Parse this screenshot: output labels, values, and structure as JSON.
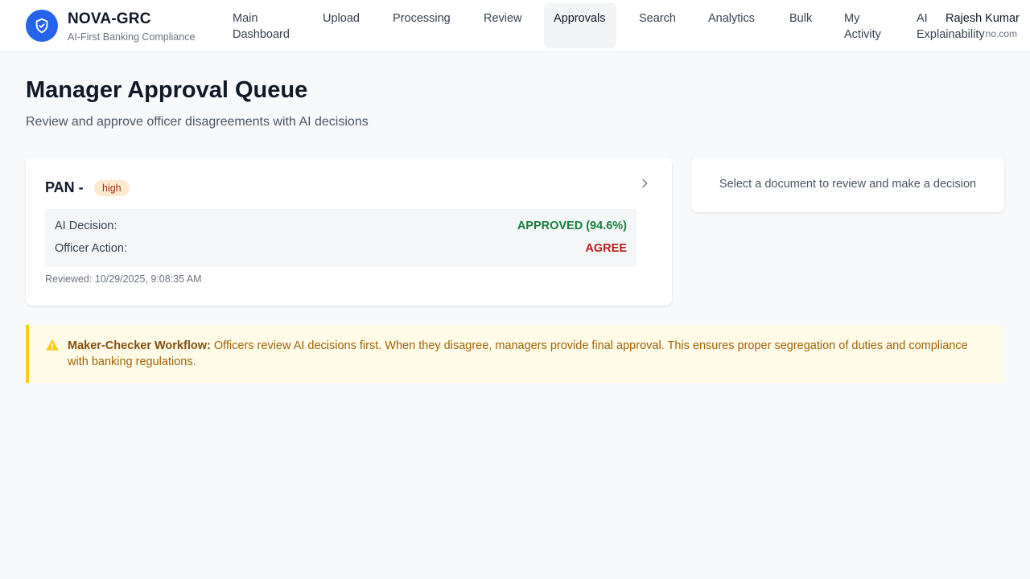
{
  "brand": {
    "title": "NOVA-GRC",
    "subtitle": "AI-First Banking Compliance",
    "logo_icon": "shield-check-icon",
    "accent_color": "#2563eb"
  },
  "nav": {
    "items": [
      {
        "label": "Main Dashboard",
        "active": false
      },
      {
        "label": "Upload",
        "active": false
      },
      {
        "label": "Processing",
        "active": false
      },
      {
        "label": "Review",
        "active": false
      },
      {
        "label": "Approvals",
        "active": true
      },
      {
        "label": "Search",
        "active": false
      },
      {
        "label": "Analytics",
        "active": false
      },
      {
        "label": "Bulk",
        "active": false
      },
      {
        "label": "My Activity",
        "active": false
      },
      {
        "label": "AI Explainability",
        "active": false
      }
    ]
  },
  "user": {
    "name": "Rajesh Kumar",
    "email_visible_fragment": "no.com"
  },
  "page": {
    "title": "Manager Approval Queue",
    "subtitle": "Review and approve officer disagreements with AI decisions"
  },
  "queue": {
    "items": [
      {
        "doc_type": "PAN -",
        "priority": "high",
        "ai_decision_label": "AI Decision:",
        "ai_decision_value": "APPROVED (94.6%)",
        "officer_action_label": "Officer Action:",
        "officer_action_value": "AGREE",
        "reviewed": "Reviewed: 10/29/2025, 9:08:35 AM",
        "ai_decision_color": "#15803d",
        "officer_action_color": "#b91c1c"
      }
    ]
  },
  "detail_panel": {
    "placeholder": "Select a document to review and make a decision"
  },
  "notice": {
    "icon": "warning-icon",
    "title": "Maker-Checker Workflow:",
    "text": "Officers review AI decisions first. When they disagree, managers provide final approval. This ensures proper segregation of duties and compliance with banking regulations."
  }
}
